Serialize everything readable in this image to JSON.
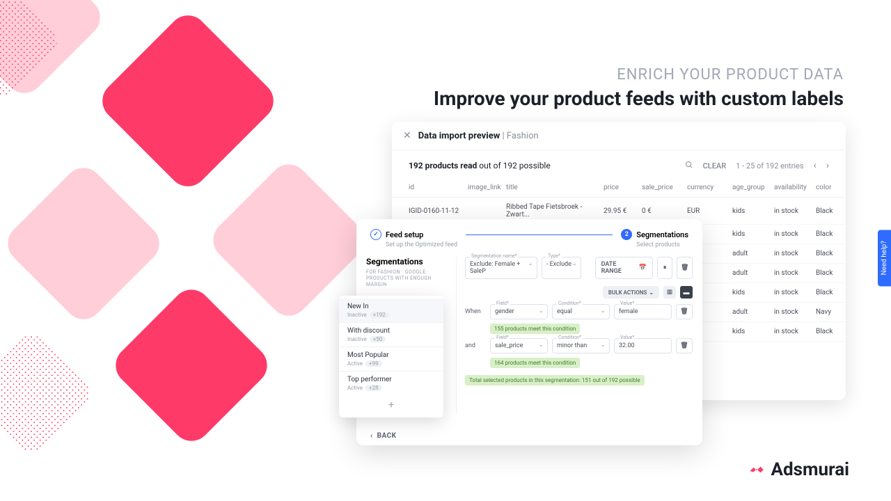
{
  "headings": {
    "eyebrow": "ENRICH YOUR PRODUCT DATA",
    "headline": "Improve your product feeds with custom labels"
  },
  "help_tab": "Need help?",
  "brand": "Adsmurai",
  "preview": {
    "title": "Data import preview",
    "category": "Fashion",
    "stats_bold": "192 products read",
    "stats_rest": " out of 192 possible",
    "clear": "CLEAR",
    "pagination": "1 - 25 of 192 entries",
    "columns": [
      "id",
      "image_link",
      "title",
      "price",
      "sale_price",
      "currency",
      "age_group",
      "availability",
      "color"
    ],
    "rows": [
      {
        "id": "IGID-0160-11-12",
        "title": "Ribbed Tape Fietsbroek - Zwart...",
        "price": "29.95 €",
        "sale_price": "0 €",
        "currency": "EUR",
        "age_group": "kids",
        "availability": "in stock",
        "color": "Black"
      },
      {
        "id": "",
        "title": "",
        "price": "",
        "sale_price": "",
        "currency": "",
        "age_group": "kids",
        "availability": "in stock",
        "color": "Black"
      },
      {
        "id": "",
        "title": "",
        "price": "",
        "sale_price": "",
        "currency": "",
        "age_group": "adult",
        "availability": "in stock",
        "color": "Black"
      },
      {
        "id": "",
        "title": "",
        "price": "",
        "sale_price": "",
        "currency": "",
        "age_group": "adult",
        "availability": "in stock",
        "color": "Black"
      },
      {
        "id": "",
        "title": "",
        "price": "",
        "sale_price": "",
        "currency": "",
        "age_group": "kids",
        "availability": "in stock",
        "color": "Black"
      },
      {
        "id": "",
        "title": "",
        "price": "",
        "sale_price": "",
        "currency": "",
        "age_group": "adult",
        "availability": "in stock",
        "color": "Navy"
      },
      {
        "id": "",
        "title": "",
        "price": "",
        "sale_price": "",
        "currency": "",
        "age_group": "kids",
        "availability": "in stock",
        "color": "Black"
      }
    ]
  },
  "seg": {
    "step1": "Feed setup",
    "step1_sub": "Set up the Optimized feed",
    "step2": "Segmentations",
    "step2_sub": "Select products",
    "heading": "Segmentations",
    "subheading": "FOR FASHION · GOOGLE · PRODUCTS WITH ENOUGH MARGIN",
    "name_field": {
      "label": "Segmentation name*",
      "value": "Exclude: Female + SaleP"
    },
    "type_field": {
      "label": "Type*",
      "value": "- Exclude"
    },
    "date_range": "DATE RANGE",
    "bulk": "BULK ACTIONS",
    "list": [
      {
        "name": "New In",
        "status": "Inactive",
        "count": "+192"
      },
      {
        "name": "With discount",
        "status": "Inactive",
        "count": "+50"
      },
      {
        "name": "Most Popular",
        "status": "Active",
        "count": "+99"
      },
      {
        "name": "Top performer",
        "status": "Active",
        "count": "+28"
      }
    ],
    "when": "When",
    "and": "and",
    "cond1": {
      "field_label": "Field*",
      "field": "gender",
      "cond_label": "Condition*",
      "cond": "equal",
      "val_label": "Value*",
      "val": "female"
    },
    "meet1": "155 products meet this condition",
    "cond2": {
      "field_label": "Field*",
      "field": "sale_price",
      "cond_label": "Condition*",
      "cond": "minor than",
      "val_label": "Value*",
      "val": "32.00"
    },
    "meet2": "164 products meet this condition",
    "total": "Total selected products in this segmentation: 151 out of 192 possible",
    "back": "BACK"
  }
}
